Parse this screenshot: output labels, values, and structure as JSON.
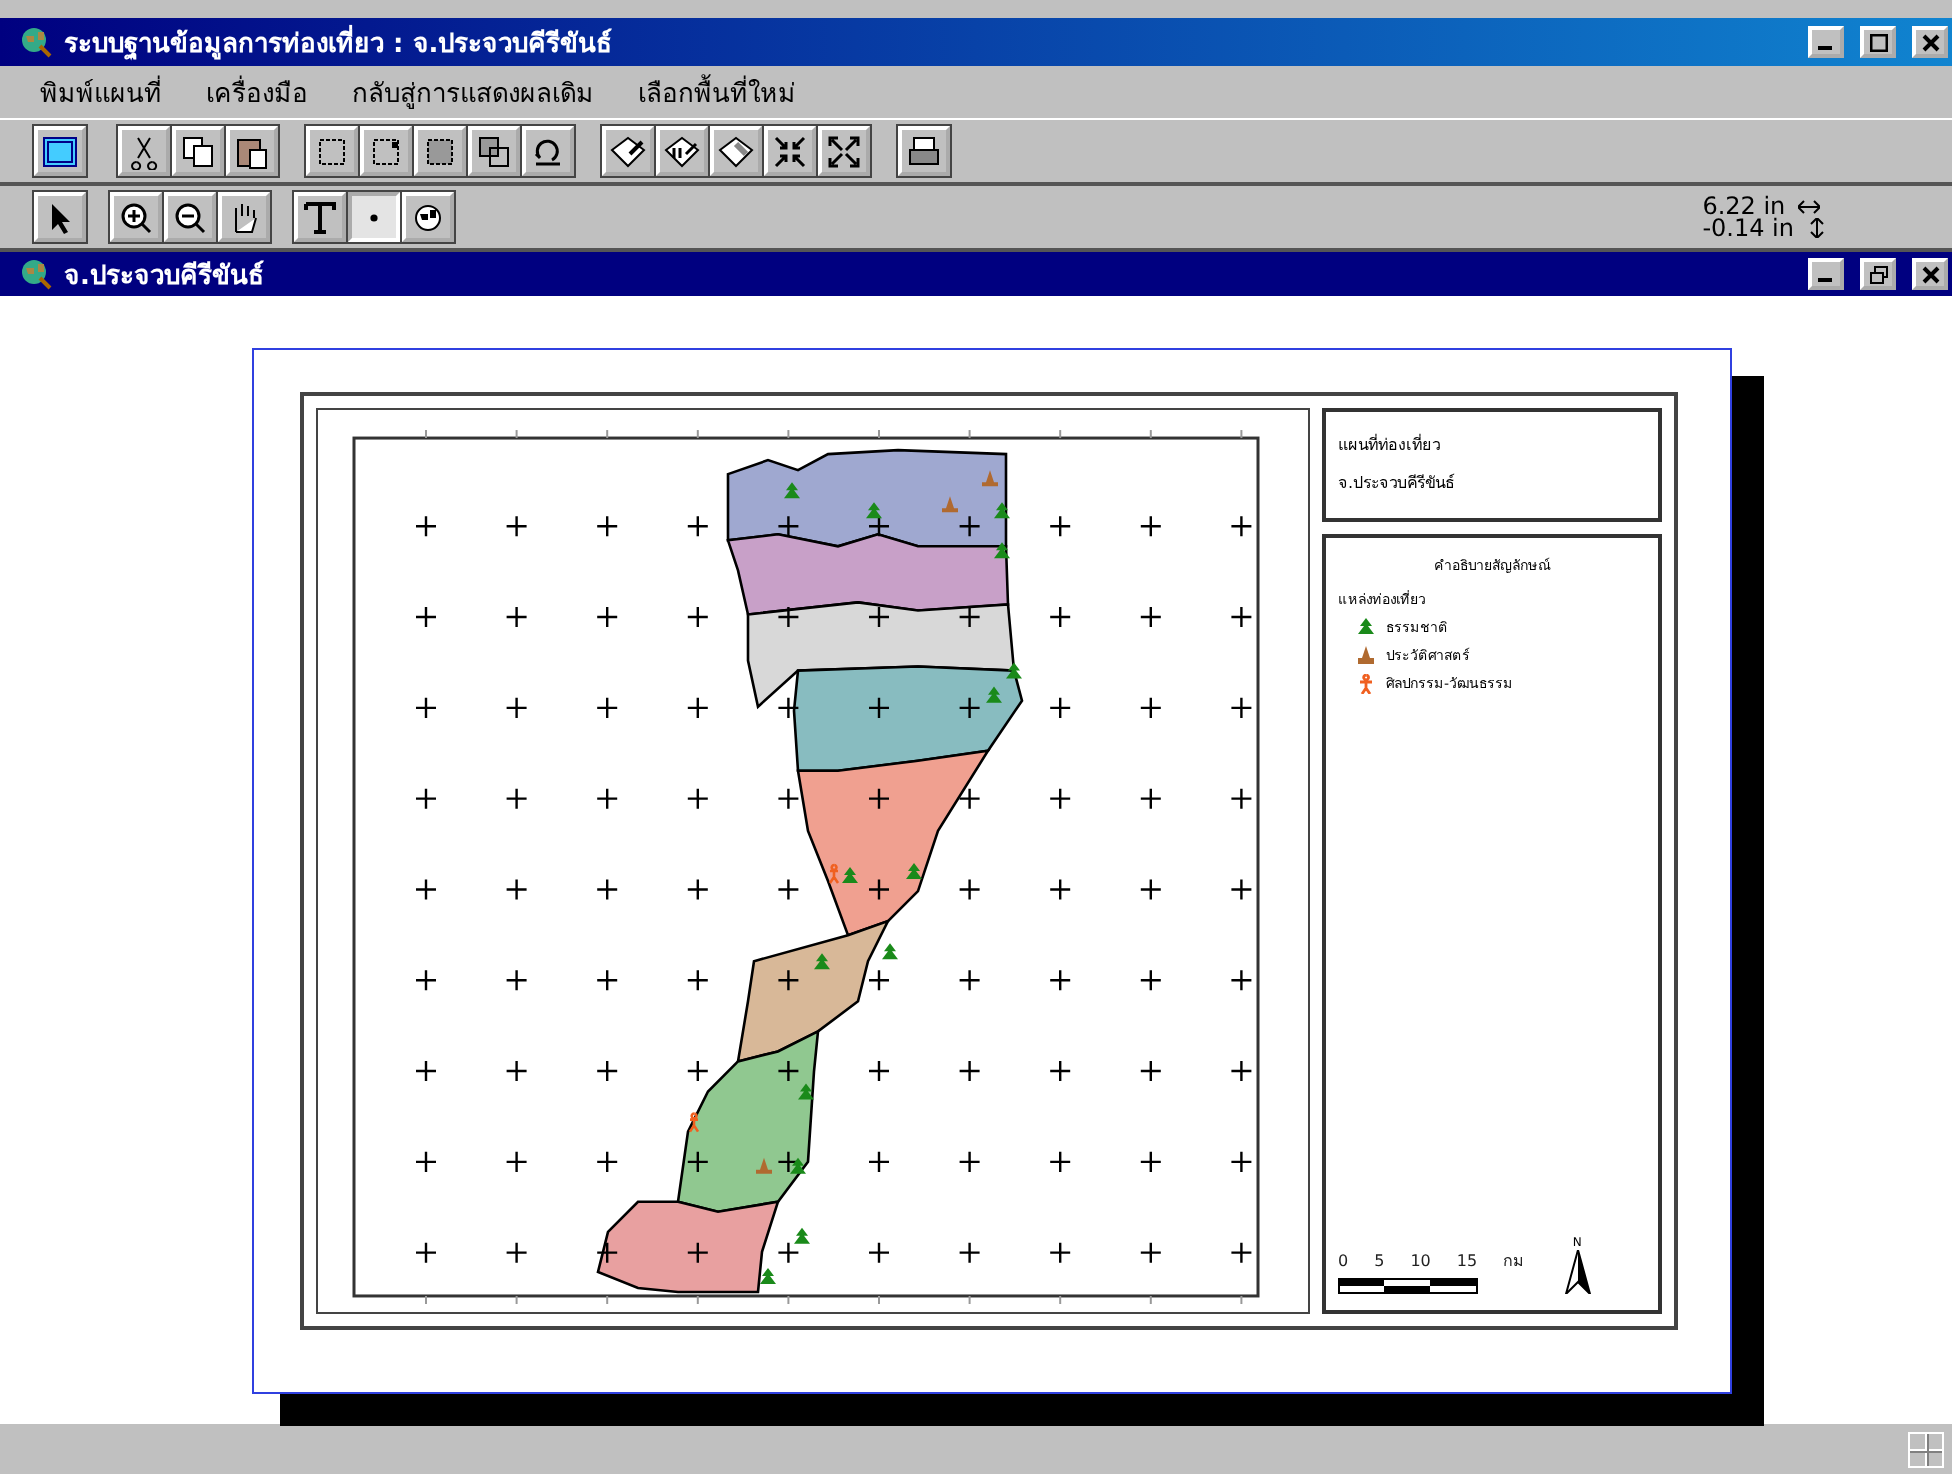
{
  "window": {
    "title": "ระบบฐานข้อมูลการท่องเที่ยว : จ.ประจวบคีรีขันธ์"
  },
  "menu": [
    "พิมพ์แผนที่",
    "เครื่องมือ",
    "กลับสู่การแสดงผลเดิม",
    "เลือกพื้นที่ใหม่"
  ],
  "tools": [
    {
      "kind": "pointer",
      "selected": false
    },
    {
      "kind": "zoom-in",
      "selected": false
    },
    {
      "kind": "zoom-out",
      "selected": false
    },
    {
      "kind": "pan",
      "selected": false
    },
    {
      "kind": "text",
      "selected": false
    },
    {
      "kind": "point",
      "selected": true
    },
    {
      "kind": "globe",
      "selected": false
    }
  ],
  "coordinates": {
    "x": "6.22 in",
    "y": "-0.14 in"
  },
  "document": {
    "title": "จ.ประจวบคีรีขันธ์"
  },
  "map_title": [
    "แผนที่ท่องเที่ยว",
    "จ.ประจวบคีรีขันธ์"
  ],
  "legend": {
    "title": "คำอธิบายสัญลักษณ์",
    "subtitle": "แหล่งท่องเที่ยว",
    "items": [
      {
        "kind": "nature",
        "label": "ธรรมชาติ"
      },
      {
        "kind": "history",
        "label": "ประวัติศาสตร์"
      },
      {
        "kind": "culture",
        "label": "ศิลปกรรม-วัฒนธรรม"
      }
    ]
  },
  "scale": {
    "ticks": [
      "0",
      "5",
      "10",
      "15"
    ],
    "unit": "กม"
  },
  "north_label": "N"
}
